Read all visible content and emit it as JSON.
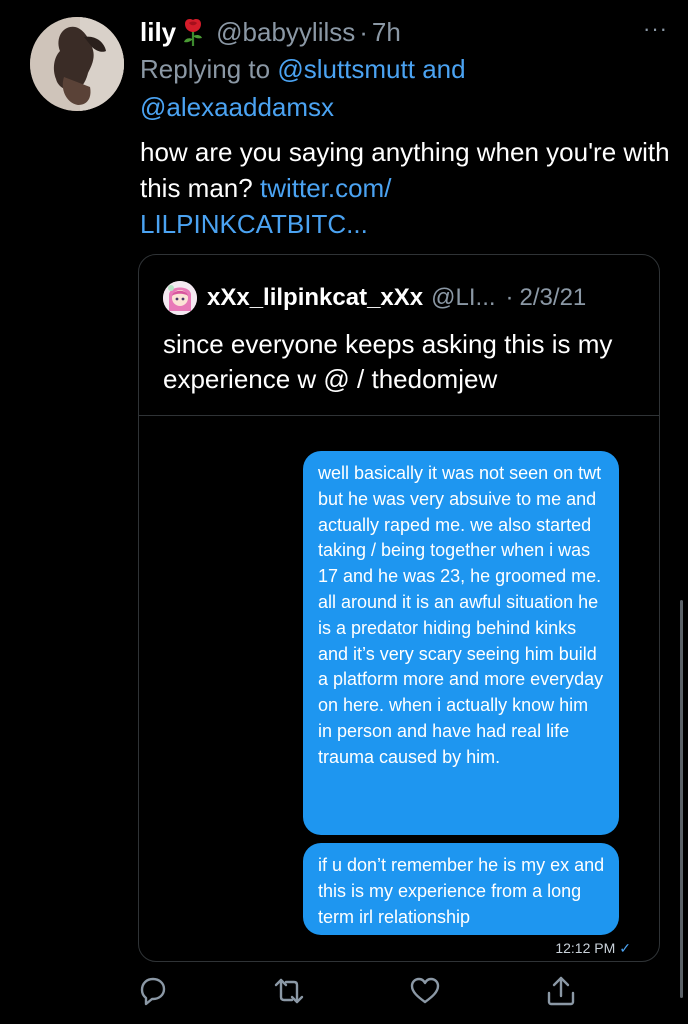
{
  "tweet": {
    "author_name": "lily",
    "author_handle": "@babyylilss",
    "separator": "·",
    "time": "7h",
    "replying_prefix": "Replying to",
    "replying_to_1": "@sluttsmutt",
    "replying_and": "and",
    "replying_to_2": "@alexaaddamsx",
    "text_main": "how are you saying anything when you're with this man?",
    "text_link_1": "twitter.com/",
    "text_link_2": "LILPINKCATBITC...",
    "more_label": "···"
  },
  "quote": {
    "author_name": "xXx_lilpinkcat_xXx",
    "author_handle": "@LI...",
    "separator": "·",
    "date": "2/3/21",
    "text": "since everyone keeps asking this is my experience w @ / thedomjew",
    "bubble_1": "well basically it was not seen on twt but he was very absuive to me and actually raped me. we also started taking / being together when i was 17 and he was 23, he groomed me. all around it is an awful situation he is a predator hiding behind kinks and it’s very scary seeing him build a platform more and more everyday on here. when i actually know him in person and have had real life trauma caused by him.",
    "bubble_2": "if u don’t remember he is my ex and this is my experience from a long term irl relationship",
    "receipt_time": "12:12 PM",
    "receipt_check": "✓"
  },
  "actions": {
    "reply_icon": "reply-icon",
    "retweet_icon": "retweet-icon",
    "like_icon": "heart-icon",
    "share_icon": "share-icon"
  },
  "colors": {
    "background": "#000000",
    "link": "#4ba3f2",
    "bubble": "#1e96f0",
    "muted": "#8b98a5"
  }
}
